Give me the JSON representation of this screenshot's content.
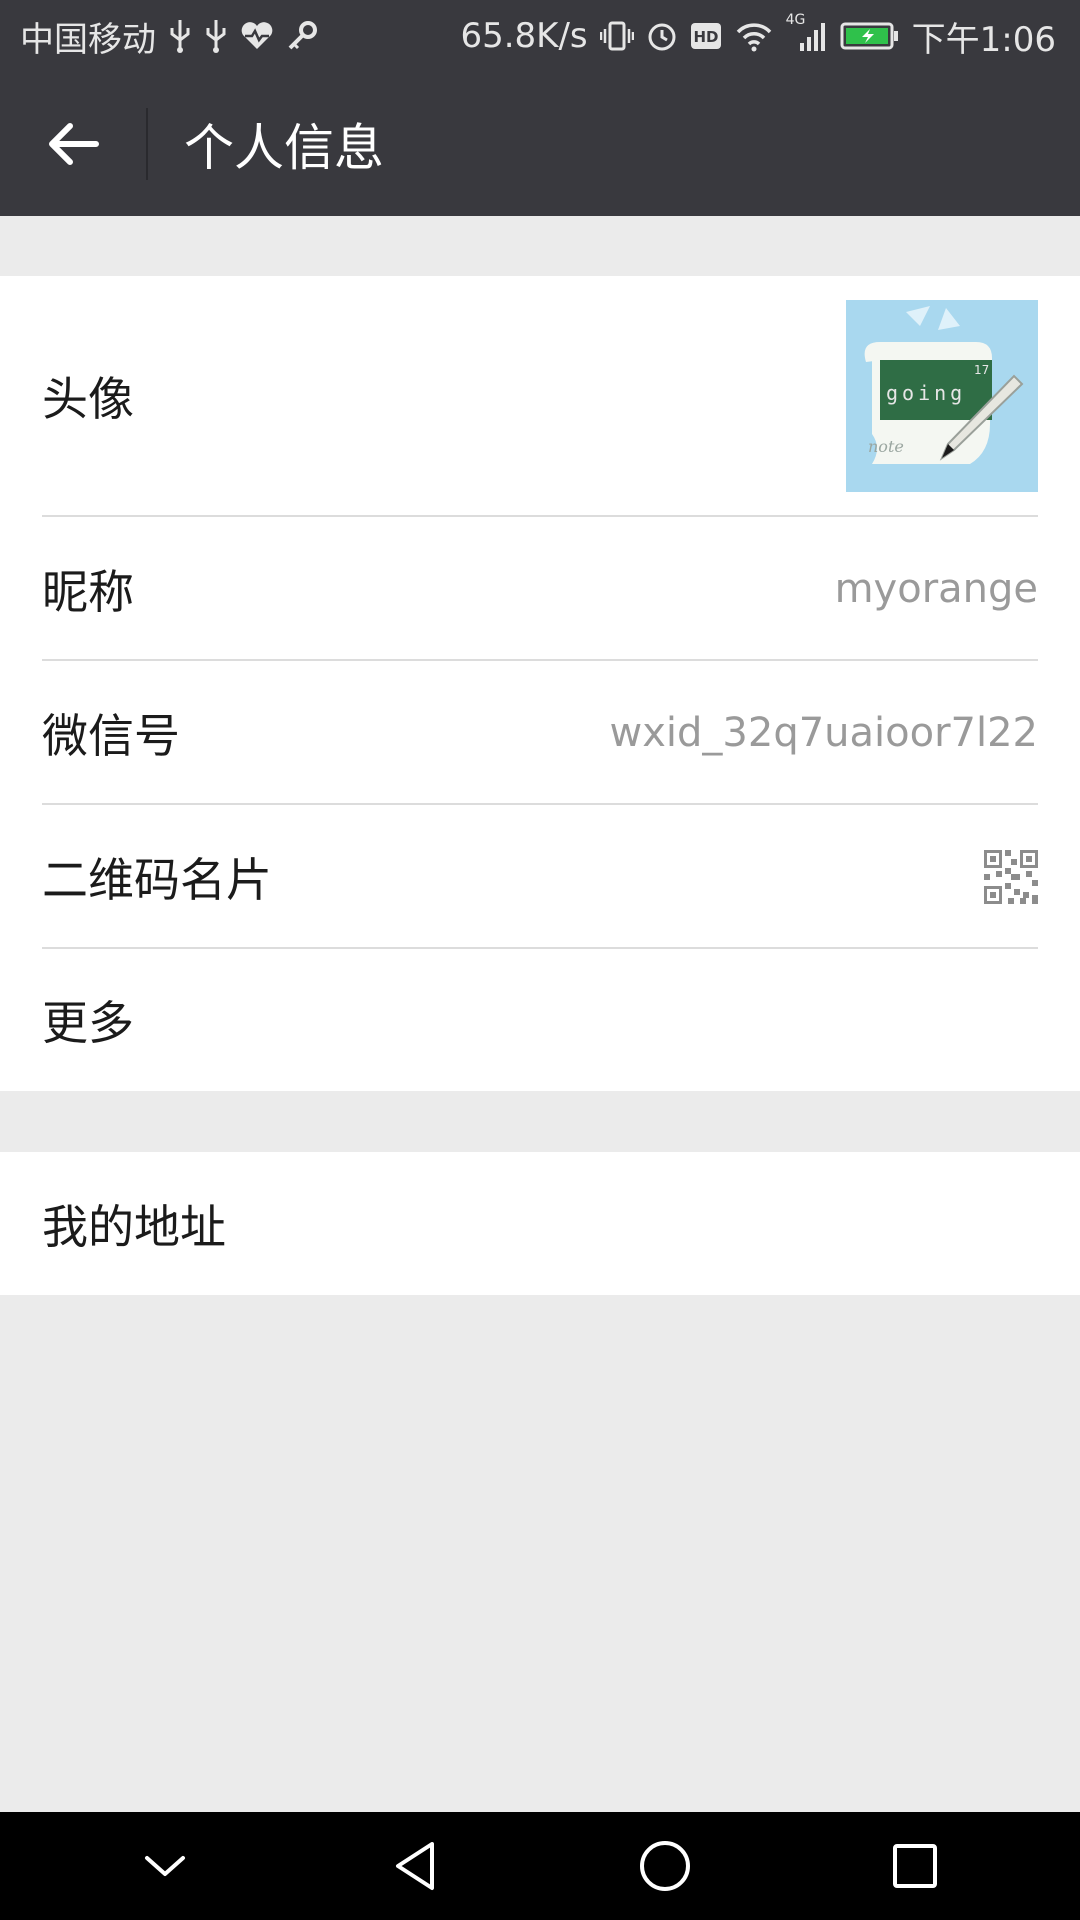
{
  "status_bar": {
    "carrier": "中国移动",
    "net_speed": "65.8K/s",
    "network_type": "4G",
    "time": "下午1:06",
    "icons": [
      "usb-icon",
      "usb-icon",
      "heart-rate-icon",
      "key-icon",
      "vibrate-icon",
      "alarm-icon",
      "hd-icon",
      "wifi-icon",
      "signal-icon",
      "battery-charging-icon"
    ]
  },
  "title_bar": {
    "title": "个人信息",
    "back_icon": "arrow-left-icon"
  },
  "profile": {
    "avatar_label": "头像",
    "avatar_image_text": [
      "17",
      "going",
      "note"
    ],
    "nickname_label": "昵称",
    "nickname_value": "myorange",
    "wechat_id_label": "微信号",
    "wechat_id_value": "wxid_32q7uaioor7l22",
    "qr_label": "二维码名片",
    "qr_icon": "qr-code-icon",
    "more_label": "更多"
  },
  "address": {
    "label": "我的地址"
  },
  "nav_bar": {
    "items": [
      "chevron-down-icon",
      "back-triangle-icon",
      "home-circle-icon",
      "recents-square-icon"
    ]
  },
  "colors": {
    "header_bg": "#39393e",
    "page_bg": "#ebebeb",
    "row_bg": "#ffffff",
    "value_text": "#9a9a9a"
  }
}
